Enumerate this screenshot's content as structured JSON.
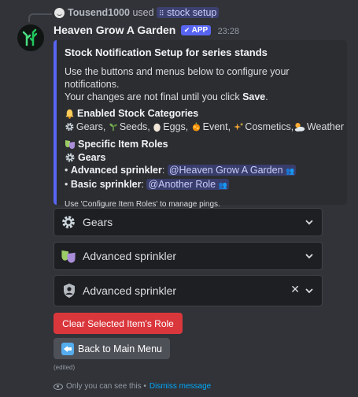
{
  "reply": {
    "user": "Tousend1000",
    "used_word": "used",
    "command": "stock setup"
  },
  "message": {
    "bot_name": "Heaven Grow A Garden",
    "app_tag": "APP",
    "timestamp": "23:28"
  },
  "embed": {
    "accent_color": "#5865f2",
    "title": "Stock Notification Setup for series stands",
    "desc_line1": "Use the buttons and menus below to configure your notifications.",
    "desc_line2_prefix": "Your changes are not final until you click ",
    "desc_line2_bold": "Save",
    "desc_line2_suffix": ".",
    "enabled_heading": "Enabled Stock Categories",
    "categories": [
      "Gears,",
      "Seeds,",
      "Eggs,",
      "Event,",
      "Cosmetics,",
      "Weather"
    ],
    "roles_heading": "Specific Item Roles",
    "gears_heading": "Gears",
    "items": [
      {
        "name": "Advanced sprinkler",
        "role": "@Heaven Grow A Garden"
      },
      {
        "name": "Basic sprinkler",
        "role": "@Another Role"
      }
    ],
    "footer_note": "Use 'Configure Item Roles' to manage pings."
  },
  "selects": {
    "category": "Gears",
    "item": "Advanced sprinkler",
    "role": "Advanced sprinkler"
  },
  "buttons": {
    "clear": "Clear Selected Item's Role",
    "back": "Back to Main Menu"
  },
  "edited": "(edited)",
  "ephemeral": {
    "text": "Only you can see this •",
    "dismiss": "Dismiss message"
  }
}
